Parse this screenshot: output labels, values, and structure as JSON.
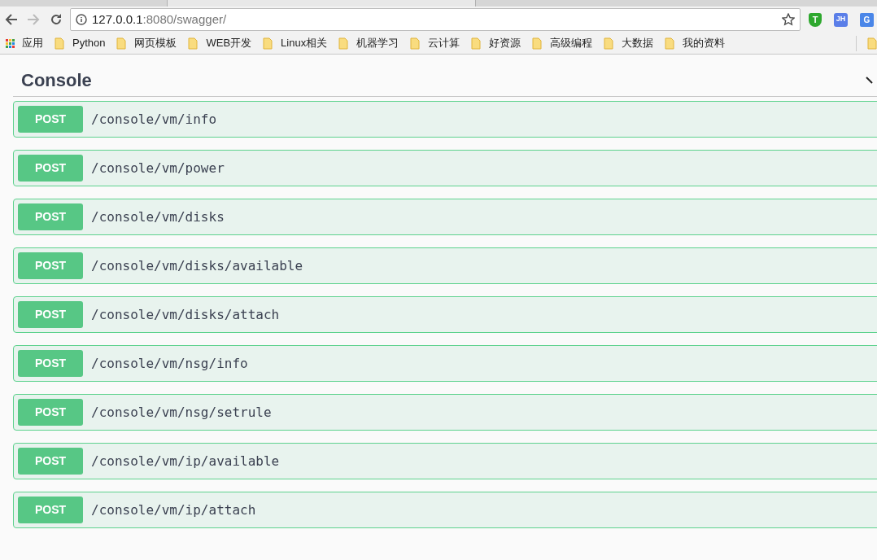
{
  "browser": {
    "address": {
      "host": "127.0.0.1",
      "rest": ":8080/swagger/"
    },
    "bookmarks": [
      {
        "kind": "apps",
        "label": "应用"
      },
      {
        "kind": "folder",
        "label": "Python"
      },
      {
        "kind": "folder",
        "label": "网页模板"
      },
      {
        "kind": "folder",
        "label": "WEB开发"
      },
      {
        "kind": "folder",
        "label": "Linux相关"
      },
      {
        "kind": "folder",
        "label": "机器学习"
      },
      {
        "kind": "folder",
        "label": "云计算"
      },
      {
        "kind": "folder",
        "label": "好资源"
      },
      {
        "kind": "folder",
        "label": "高级编程"
      },
      {
        "kind": "folder",
        "label": "大数据"
      },
      {
        "kind": "folder",
        "label": "我的资料"
      }
    ],
    "extensions": [
      {
        "kind": "shield",
        "label": "T"
      },
      {
        "kind": "badge",
        "label": "JH"
      },
      {
        "kind": "translate",
        "label": "G"
      }
    ]
  },
  "section": {
    "title": "Console",
    "expanded": true,
    "operations": [
      {
        "method": "POST",
        "path": "/console/vm/info"
      },
      {
        "method": "POST",
        "path": "/console/vm/power"
      },
      {
        "method": "POST",
        "path": "/console/vm/disks"
      },
      {
        "method": "POST",
        "path": "/console/vm/disks/available"
      },
      {
        "method": "POST",
        "path": "/console/vm/disks/attach"
      },
      {
        "method": "POST",
        "path": "/console/vm/nsg/info"
      },
      {
        "method": "POST",
        "path": "/console/vm/nsg/setrule"
      },
      {
        "method": "POST",
        "path": "/console/vm/ip/available"
      },
      {
        "method": "POST",
        "path": "/console/vm/ip/attach"
      }
    ]
  }
}
